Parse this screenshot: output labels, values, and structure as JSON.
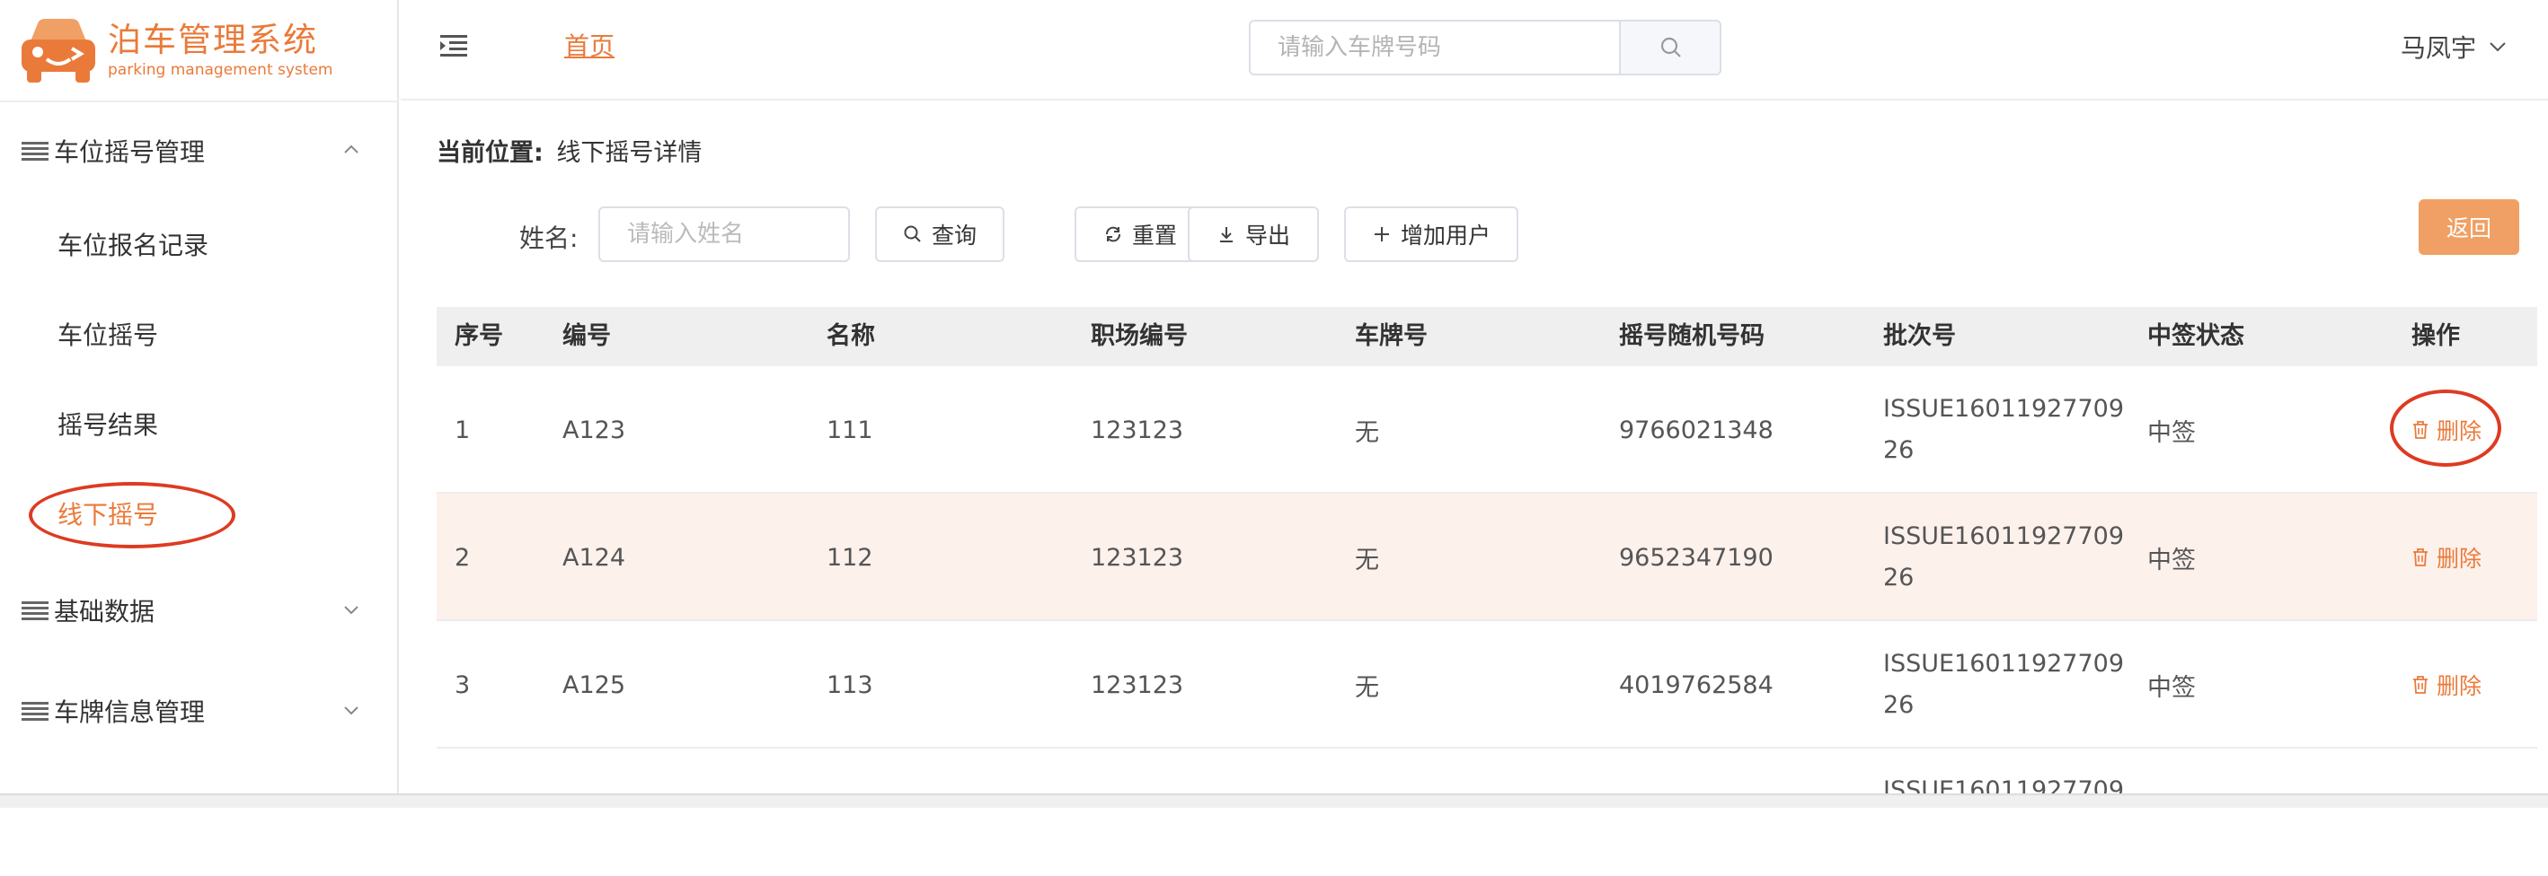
{
  "app": {
    "title": "泊车管理系统",
    "subtitle": "parking management system",
    "brand_color": "#ea7a3a"
  },
  "sidebar": {
    "groups": [
      {
        "label": "车位摇号管理",
        "expanded": true,
        "items": [
          {
            "label": "车位报名记录",
            "active": false
          },
          {
            "label": "车位摇号",
            "active": false
          },
          {
            "label": "摇号结果",
            "active": false
          },
          {
            "label": "线下摇号",
            "active": true
          }
        ]
      },
      {
        "label": "基础数据",
        "expanded": false
      },
      {
        "label": "车牌信息管理",
        "expanded": false
      }
    ]
  },
  "header": {
    "home_label": "首页",
    "search_placeholder": "请输入车牌号码",
    "user_name": "马凤宇"
  },
  "breadcrumb": {
    "label": "当前位置:",
    "value": "线下摇号详情"
  },
  "filter": {
    "name_label": "姓名:",
    "name_placeholder": "请输入姓名",
    "query_label": "查询",
    "reset_label": "重置",
    "export_label": "导出",
    "add_user_label": "增加用户",
    "back_label": "返回"
  },
  "table": {
    "columns": [
      "序号",
      "编号",
      "名称",
      "职场编号",
      "车牌号",
      "摇号随机号码",
      "批次号",
      "中签状态",
      "操作"
    ],
    "delete_label": "删除",
    "rows": [
      {
        "index": "1",
        "code": "A123",
        "name": "111",
        "workplace": "123123",
        "plate": "无",
        "random": "9766021348",
        "batch": "ISSUE1601192770926",
        "status": "中签"
      },
      {
        "index": "2",
        "code": "A124",
        "name": "112",
        "workplace": "123123",
        "plate": "无",
        "random": "9652347190",
        "batch": "ISSUE1601192770926",
        "status": "中签"
      },
      {
        "index": "3",
        "code": "A125",
        "name": "113",
        "workplace": "123123",
        "plate": "无",
        "random": "4019762584",
        "batch": "ISSUE1601192770926",
        "status": "中签"
      },
      {
        "index": "",
        "code": "",
        "name": "",
        "workplace": "",
        "plate": "",
        "random": "",
        "batch": "ISSUE16011927709",
        "status": ""
      }
    ]
  },
  "colors": {
    "accent": "#ea7a3a",
    "highlight_row": "#fdf1ec",
    "annotation_circle": "#dd3b22",
    "back_button": "#f0a064"
  }
}
